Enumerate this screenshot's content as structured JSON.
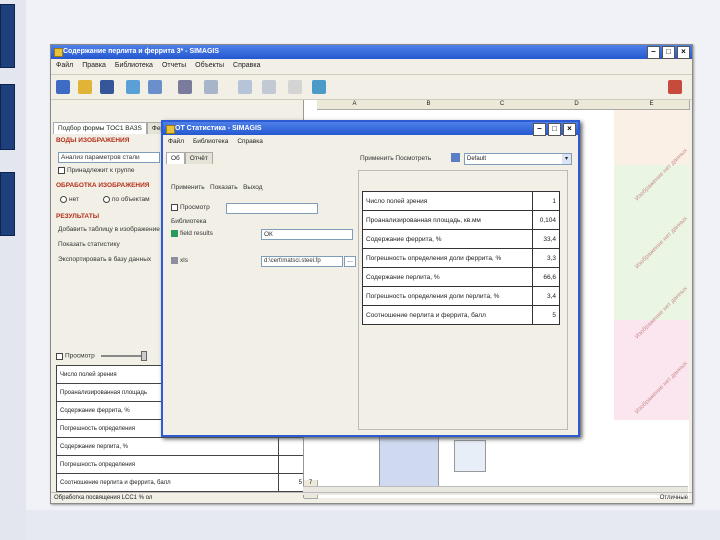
{
  "window": {
    "title": "Содержание перлита и феррита 3* - SIMAGIS",
    "menu": [
      "Файл",
      "Правка",
      "Библиотека",
      "Отчеты",
      "Объекты",
      "Справка"
    ],
    "status_left": "Обработка посвящения LCC1 % ол",
    "status_right": "Отличные"
  },
  "left_panel": {
    "tabs": [
      "Подбор формы TOC1 BA3S",
      "Фер..."
    ],
    "section_source": "ВОДЫ ИЗОБРАЖЕНИЯ",
    "source_label": "Анализ параметров стали",
    "checkbox_1": "Принадлежит к группе",
    "section_processing": "ОБРАБОТКА ИЗОБРАЖЕНИЯ",
    "radio_1": "нет",
    "radio_2": "по объектам",
    "section_results": "РЕЗУЛЬТАТЫ",
    "result_1": "Добавить таблицу в изображение",
    "result_2": "Показать статистику",
    "result_3": "Экспортировать в базу данных",
    "preview_label": "Просмотр",
    "stats_rows": [
      {
        "label": "Число полей зрения",
        "value": ""
      },
      {
        "label": "Проанализированная площадь",
        "value": ""
      },
      {
        "label": "Содержание феррита, %",
        "value": ""
      },
      {
        "label": "Погрешность определения",
        "value": ""
      },
      {
        "label": "Содержание перлита, %",
        "value": ""
      },
      {
        "label": "Погрешность определения",
        "value": ""
      },
      {
        "label": "Соотношение перлита и феррита, балл",
        "value": "5"
      }
    ]
  },
  "grid": {
    "columns": [
      "A",
      "B",
      "C",
      "D",
      "E"
    ],
    "rows": [
      "1",
      "2",
      "3",
      "4",
      "5",
      "6",
      "7"
    ],
    "watermark": "Изображение нет данных"
  },
  "dialog": {
    "title": "ОТ Статистика - SIMAGIS",
    "menu": [
      "Файл",
      "Библиотека",
      "Справка"
    ],
    "tabs": [
      "Об",
      "Отчёт"
    ],
    "field_top": "ОК",
    "apply_label": "Применить",
    "apply_label_2": "Показать",
    "apply_label_3": "Выход",
    "preview_label": "Просмотр",
    "lib_label": "Библиотека",
    "field_results_label": "field results",
    "field_results_value": "ОК",
    "xls_label": "xls",
    "xls_value": "d:\\cert\\matsci.steel.fp",
    "browse_label": "...",
    "right_apply": "Применить",
    "right_show": "Посмотреть",
    "template_value": "Default",
    "table": [
      {
        "label": "Число полей зрения",
        "value": "1"
      },
      {
        "label": "Проанализированная площадь, кв.мм",
        "value": "0,104"
      },
      {
        "label": "Содержание феррита, %",
        "value": "33,4"
      },
      {
        "label": "Погрешность определения доли феррита, %",
        "value": "3,3"
      },
      {
        "label": "Содержание перлита, %",
        "value": "66,6"
      },
      {
        "label": "Погрешность определения доли перлита, %",
        "value": "3,4"
      },
      {
        "label": "Соотношение перлита и феррита, балл",
        "value": "5"
      }
    ]
  }
}
